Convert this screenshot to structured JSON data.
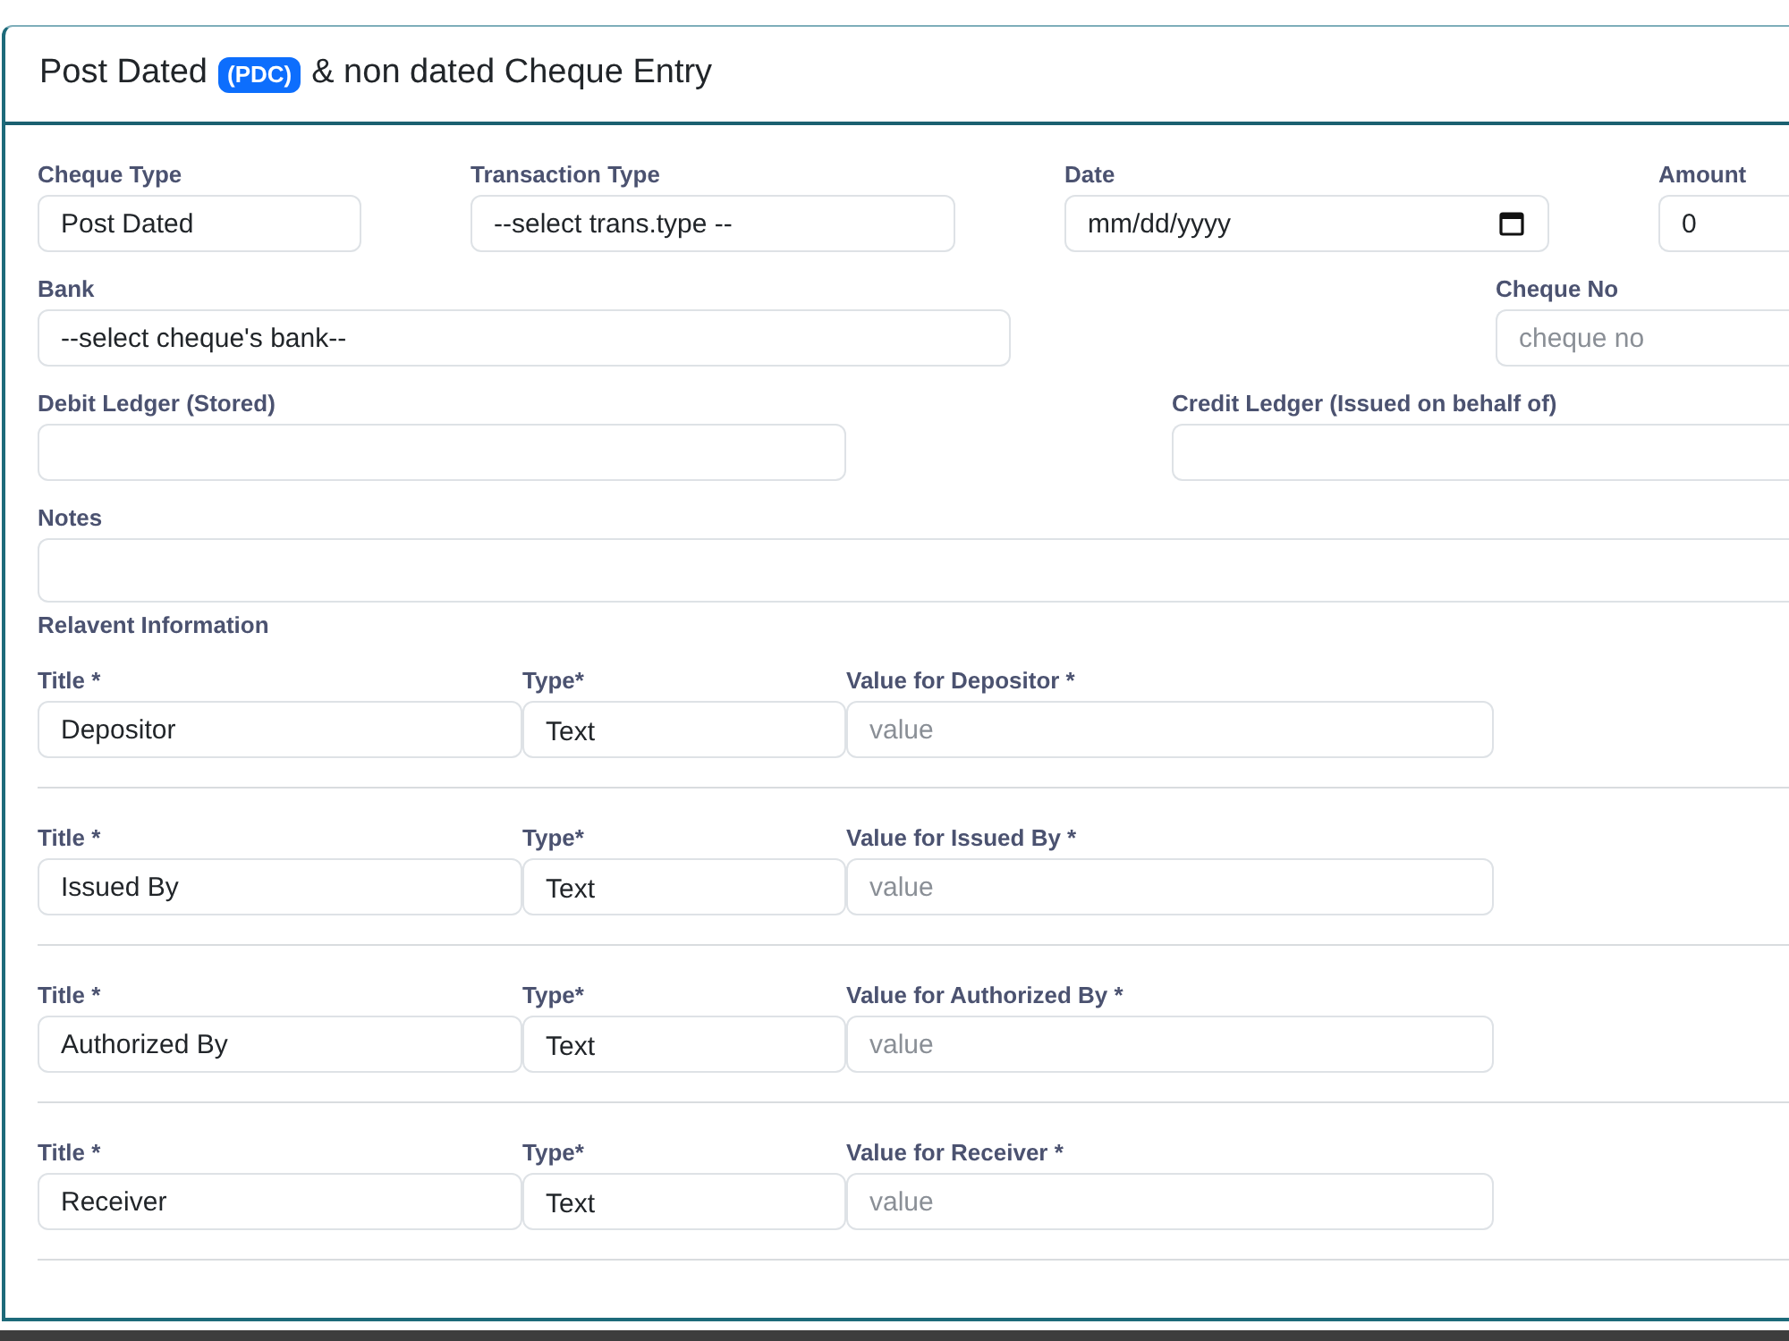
{
  "header": {
    "title_start": "Post Dated",
    "badge": "(PDC)",
    "title_end": "& non dated Cheque Entry"
  },
  "fields": {
    "cheque_type": {
      "label": "Cheque Type",
      "value": "Post Dated"
    },
    "transaction_type": {
      "label": "Transaction Type",
      "value": "--select trans.type --"
    },
    "date": {
      "label": "Date",
      "placeholder": "mm/dd/yyyy"
    },
    "amount": {
      "label": "Amount",
      "value": "0"
    },
    "bank": {
      "label": "Bank",
      "value": "--select cheque's bank--"
    },
    "cheque_no": {
      "label": "Cheque No",
      "placeholder": "cheque no"
    },
    "debit_ledger": {
      "label": "Debit Ledger (Stored)"
    },
    "credit_ledger": {
      "label": "Credit Ledger (Issued on behalf of)"
    },
    "notes": {
      "label": "Notes"
    }
  },
  "relevant_information": {
    "heading": "Relavent Information",
    "entries": [
      {
        "title_label": "Title *",
        "title_value": "Depositor",
        "type_label": "Type*",
        "type_value": "Text",
        "value_label": "Value for Depositor *",
        "value_placeholder": "value"
      },
      {
        "title_label": "Title *",
        "title_value": "Issued By",
        "type_label": "Type*",
        "type_value": "Text",
        "value_label": "Value for Issued By *",
        "value_placeholder": "value"
      },
      {
        "title_label": "Title *",
        "title_value": "Authorized By",
        "type_label": "Type*",
        "type_value": "Text",
        "value_label": "Value for Authorized By *",
        "value_placeholder": "value"
      },
      {
        "title_label": "Title *",
        "title_value": "Receiver",
        "type_label": "Type*",
        "type_value": "Text",
        "value_label": "Value for Receiver *",
        "value_placeholder": "value"
      }
    ]
  }
}
